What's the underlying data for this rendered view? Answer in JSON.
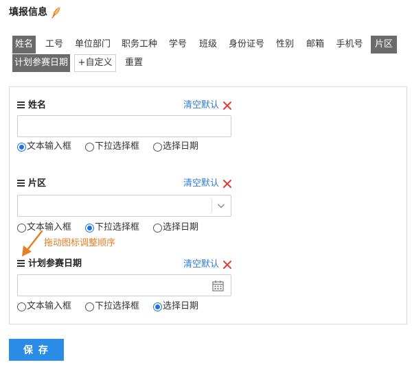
{
  "header": {
    "title": "填报信息"
  },
  "tags": {
    "items": [
      {
        "label": "姓名",
        "selected": true
      },
      {
        "label": "工号",
        "selected": false
      },
      {
        "label": "单位部门",
        "selected": false
      },
      {
        "label": "职务工种",
        "selected": false
      },
      {
        "label": "学号",
        "selected": false
      },
      {
        "label": "班级",
        "selected": false
      },
      {
        "label": "身份证号",
        "selected": false
      },
      {
        "label": "性别",
        "selected": false
      },
      {
        "label": "邮箱",
        "selected": false
      },
      {
        "label": "手机号",
        "selected": false
      },
      {
        "label": "片区",
        "selected": true
      },
      {
        "label": "计划参赛日期",
        "selected": true
      }
    ],
    "add_label": "+自定义",
    "reset_label": "重置"
  },
  "fields": [
    {
      "label": "姓名",
      "clear_label": "清空默认",
      "control": "text",
      "value": "",
      "options": [
        "文本输入框",
        "下拉选择框",
        "选择日期"
      ],
      "selected_option": "文本输入框"
    },
    {
      "label": "片区",
      "clear_label": "清空默认",
      "control": "select",
      "value": "",
      "options": [
        "文本输入框",
        "下拉选择框",
        "选择日期"
      ],
      "selected_option": "下拉选择框"
    },
    {
      "label": "计划参赛日期",
      "clear_label": "清空默认",
      "control": "date",
      "value": "",
      "options": [
        "文本输入框",
        "下拉选择框",
        "选择日期"
      ],
      "selected_option": "选择日期"
    }
  ],
  "hint": {
    "text": "拖动图标调整顺序"
  },
  "footer": {
    "save_label": "保 存"
  },
  "colors": {
    "link": "#2b7bd6",
    "delete": "#e53935",
    "selected_tag_bg": "#6b6b6b",
    "radio_on": "#1a73e8",
    "hint": "#e67e22",
    "primary_button": "#2b8ce6"
  },
  "icons": {
    "title_icon": "feather-icon",
    "drag": "drag-handle-icon",
    "delete": "close-icon",
    "select": "chevron-down-icon",
    "date": "calendar-icon",
    "hint": "arrow-up-left-icon"
  }
}
